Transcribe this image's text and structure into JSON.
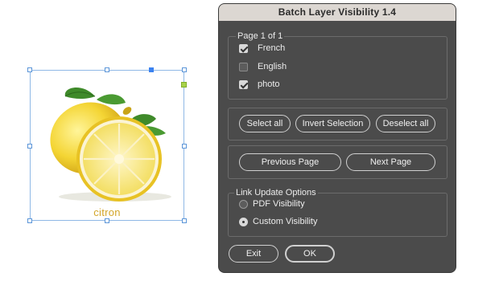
{
  "canvas": {
    "caption": "citron"
  },
  "dialog": {
    "title": "Batch Layer Visibility 1.4",
    "page_group": {
      "label": "Page 1 of 1",
      "layers": [
        {
          "name": "French",
          "checked": true
        },
        {
          "name": "English",
          "checked": false
        },
        {
          "name": "photo",
          "checked": true
        }
      ]
    },
    "selection_buttons": {
      "select_all": "Select all",
      "invert": "Invert Selection",
      "deselect_all": "Deselect all"
    },
    "page_buttons": {
      "previous": "Previous Page",
      "next": "Next Page"
    },
    "link_options": {
      "label": "Link Update Options",
      "options": [
        {
          "label": "PDF Visibility",
          "selected": false
        },
        {
          "label": "Custom Visibility",
          "selected": true
        }
      ]
    },
    "footer": {
      "exit": "Exit",
      "ok": "OK"
    }
  },
  "colors": {
    "dialog_bg": "#4b4b4b",
    "titlebar_bg": "#dcd7d2",
    "selection_frame": "#8fb8e6",
    "caption_color": "#d3a62a"
  }
}
